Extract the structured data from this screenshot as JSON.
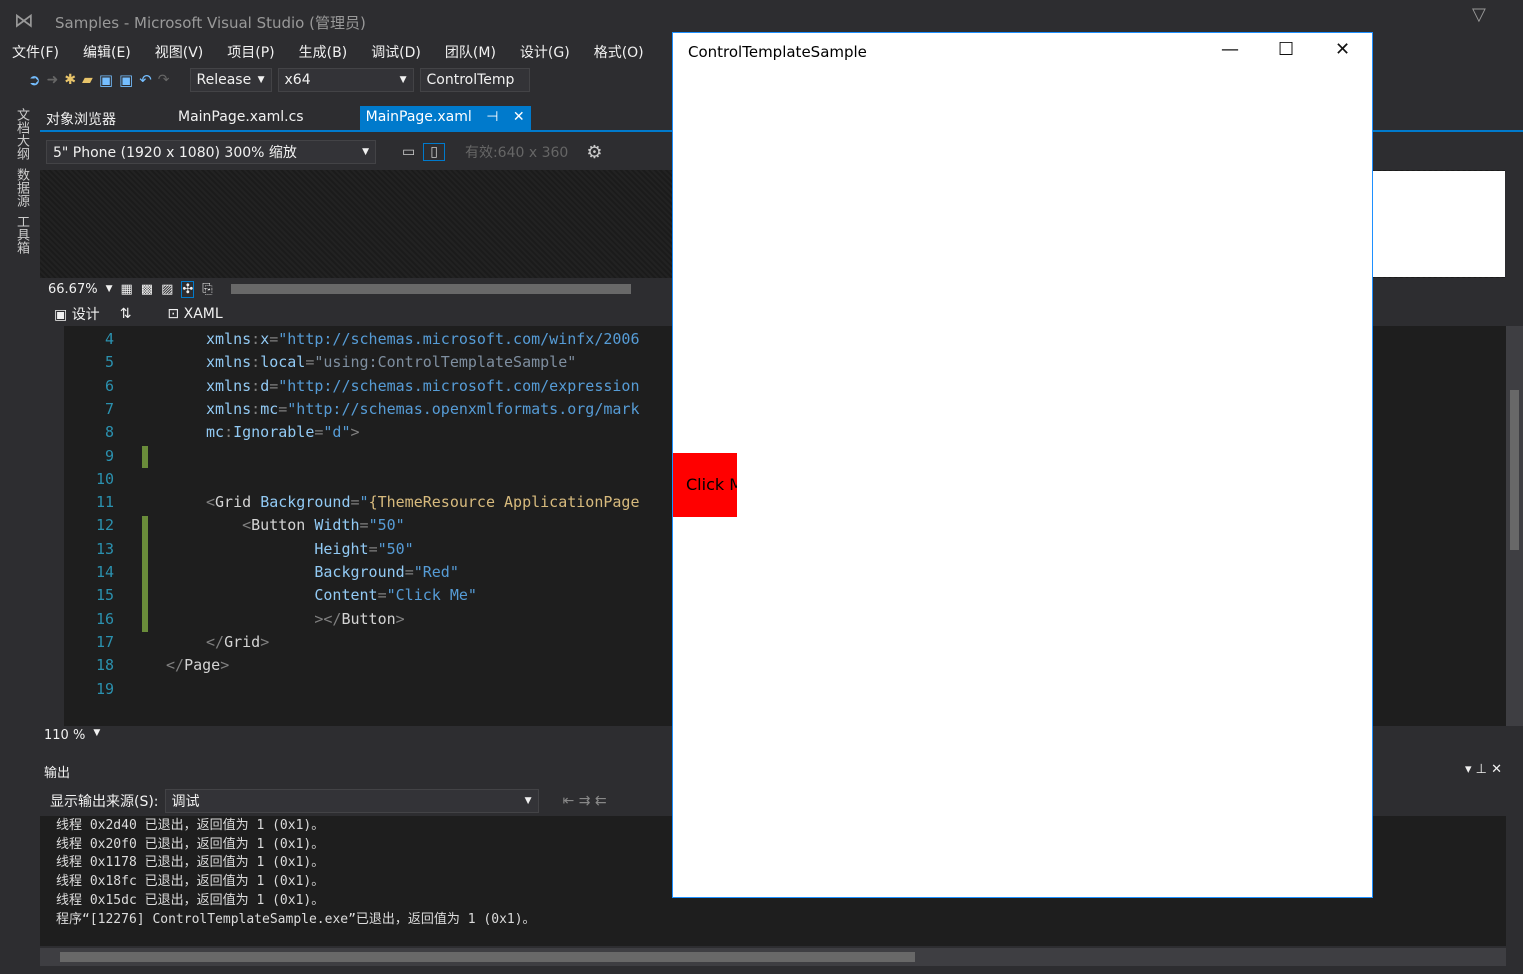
{
  "window": {
    "title": "Samples - Microsoft Visual Studio (管理员)"
  },
  "menu": [
    "文件(F)",
    "编辑(E)",
    "视图(V)",
    "项目(P)",
    "生成(B)",
    "调试(D)",
    "团队(M)",
    "设计(G)",
    "格式(O)"
  ],
  "toolbar": {
    "config": "Release",
    "platform": "x64",
    "startup": "ControlTemp"
  },
  "side_tabs": [
    "文档大纲",
    "数据源",
    "工具箱"
  ],
  "tabs": [
    {
      "label": "对象浏览器"
    },
    {
      "label": "MainPage.xaml.cs"
    },
    {
      "label": "MainPage.xaml",
      "active": true
    }
  ],
  "designer": {
    "device": "5\" Phone (1920 x 1080) 300% 缩放",
    "effective": "有效:640 x 360",
    "zoom": "66.67%",
    "design_tab": "设计",
    "xaml_tab": "XAML"
  },
  "editor": {
    "zoom": "110 %",
    "lines": [
      {
        "n": "4",
        "parts": [
          [
            "an",
            "xmlns"
          ],
          [
            "pu",
            ":"
          ],
          [
            "an",
            "x"
          ],
          [
            "pu",
            "="
          ],
          [
            "av",
            "\"http://schemas.microsoft.com/winfx/2006"
          ]
        ]
      },
      {
        "n": "5",
        "parts": [
          [
            "an",
            "xmlns"
          ],
          [
            "pu",
            ":"
          ],
          [
            "an",
            "local"
          ],
          [
            "pu",
            "="
          ],
          [
            "dim",
            "\"using:ControlTemplateSample\""
          ]
        ]
      },
      {
        "n": "6",
        "parts": [
          [
            "an",
            "xmlns"
          ],
          [
            "pu",
            ":"
          ],
          [
            "an",
            "d"
          ],
          [
            "pu",
            "="
          ],
          [
            "av",
            "\"http://schemas.microsoft.com/expression"
          ]
        ]
      },
      {
        "n": "7",
        "parts": [
          [
            "an",
            "xmlns"
          ],
          [
            "pu",
            ":"
          ],
          [
            "an",
            "mc"
          ],
          [
            "pu",
            "="
          ],
          [
            "av",
            "\"http://schemas.openxmlformats.org/mark"
          ]
        ]
      },
      {
        "n": "8",
        "parts": [
          [
            "an",
            "mc"
          ],
          [
            "pu",
            ":"
          ],
          [
            "an",
            "Ignorable"
          ],
          [
            "pu",
            "="
          ],
          [
            "av",
            "\"d\""
          ],
          [
            "pu",
            ">"
          ]
        ]
      },
      {
        "n": "9",
        "parts": []
      },
      {
        "n": "10",
        "parts": []
      },
      {
        "n": "11",
        "parts": [
          [
            "pu",
            "<"
          ],
          [
            "tg",
            "Grid "
          ],
          [
            "an",
            "Background"
          ],
          [
            "pu",
            "="
          ],
          [
            "av",
            "\""
          ],
          [
            "ex",
            "{ThemeResource ApplicationPage"
          ]
        ]
      },
      {
        "n": "12",
        "parts": [
          [
            "pu",
            "    <"
          ],
          [
            "tg",
            "Button "
          ],
          [
            "an",
            "Width"
          ],
          [
            "pu",
            "="
          ],
          [
            "av",
            "\"50\""
          ]
        ]
      },
      {
        "n": "13",
        "parts": [
          [
            "tg",
            "            "
          ],
          [
            "an",
            "Height"
          ],
          [
            "pu",
            "="
          ],
          [
            "av",
            "\"50\""
          ]
        ]
      },
      {
        "n": "14",
        "parts": [
          [
            "tg",
            "            "
          ],
          [
            "an",
            "Background"
          ],
          [
            "pu",
            "="
          ],
          [
            "av",
            "\"Red\""
          ]
        ]
      },
      {
        "n": "15",
        "parts": [
          [
            "tg",
            "            "
          ],
          [
            "an",
            "Content"
          ],
          [
            "pu",
            "="
          ],
          [
            "av",
            "\"Click Me\""
          ]
        ]
      },
      {
        "n": "16",
        "parts": [
          [
            "pu",
            "            ></"
          ],
          [
            "tg",
            "Button"
          ],
          [
            "pu",
            ">"
          ]
        ]
      },
      {
        "n": "17",
        "parts": [
          [
            "pu",
            "</"
          ],
          [
            "tg",
            "Grid"
          ],
          [
            "pu",
            ">"
          ]
        ]
      },
      {
        "n": "18",
        "parts": [
          [
            "pu",
            "</"
          ],
          [
            "tg",
            "Page"
          ],
          [
            "pu",
            ">"
          ]
        ]
      },
      {
        "n": "19",
        "parts": []
      }
    ]
  },
  "output": {
    "title": "输出",
    "source_label": "显示输出来源(S):",
    "source": "调试",
    "lines": [
      "线程 0x2d40 已退出，返回值为 1 (0x1)。",
      "线程 0x20f0 已退出，返回值为 1 (0x1)。",
      "线程 0x1178 已退出，返回值为 1 (0x1)。",
      "线程 0x18fc 已退出，返回值为 1 (0x1)。",
      "线程 0x15dc 已退出，返回值为 1 (0x1)。",
      "程序“[12276] ControlTemplateSample.exe”已退出，返回值为 1 (0x1)。"
    ]
  },
  "app_window": {
    "title": "ControlTemplateSample",
    "button_content": "Click Me",
    "button_color": "#ff0000"
  },
  "colors": {
    "accent": "#007acc",
    "bg": "#2d2d30",
    "editor": "#1e1e1e"
  }
}
